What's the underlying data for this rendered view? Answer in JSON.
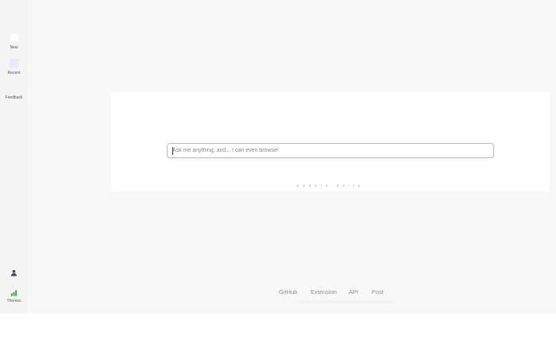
{
  "sidebar": {
    "new_label": "New",
    "recent_label": "Recent",
    "feedback_label": "Feedback",
    "theme_label": "Themes"
  },
  "search": {
    "placeholder": "Ask me anything, and... I can even browse!"
  },
  "tagline": "update daily",
  "footer": {
    "links": [
      "GitHub",
      "Extension",
      "API",
      "Post"
    ]
  },
  "colors": {
    "background": "#f8f8f9",
    "panel": "#ffffff",
    "accent_green": "#2ea043",
    "recent_tint": "#e9e8f7"
  }
}
